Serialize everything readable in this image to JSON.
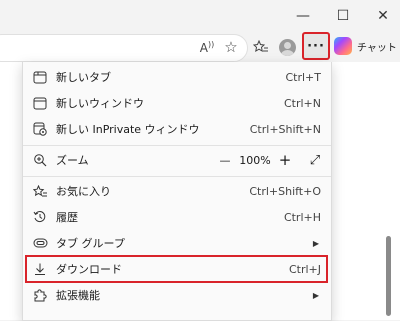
{
  "window": {
    "minimize_glyph": "—",
    "maximize_glyph": "☐",
    "close_glyph": "✕"
  },
  "toolbar": {
    "read_aloud_glyph": "A",
    "favorite_glyph": "☆",
    "favorites_glyph": "☆",
    "more_label": "···",
    "chat_label": "チャット"
  },
  "menu": {
    "new_tab": {
      "label": "新しいタブ",
      "shortcut": "Ctrl+T"
    },
    "new_window": {
      "label": "新しいウィンドウ",
      "shortcut": "Ctrl+N"
    },
    "new_inprivate": {
      "label": "新しい InPrivate ウィンドウ",
      "shortcut": "Ctrl+Shift+N"
    },
    "zoom": {
      "label": "ズーム",
      "minus": "—",
      "value": "100%",
      "plus": "+",
      "expand": "⤢"
    },
    "favorites": {
      "label": "お気に入り",
      "shortcut": "Ctrl+Shift+O"
    },
    "history": {
      "label": "履歴",
      "shortcut": "Ctrl+H"
    },
    "tab_groups": {
      "label": "タブ グループ",
      "arrow": "▶"
    },
    "downloads": {
      "label": "ダウンロード",
      "shortcut": "Ctrl+J"
    },
    "extensions": {
      "label": "拡張機能",
      "arrow": "▶"
    }
  },
  "colors": {
    "highlight": "#d9232a",
    "menu_bg": "#fafafa",
    "chrome_bg": "#f3f3f3"
  }
}
